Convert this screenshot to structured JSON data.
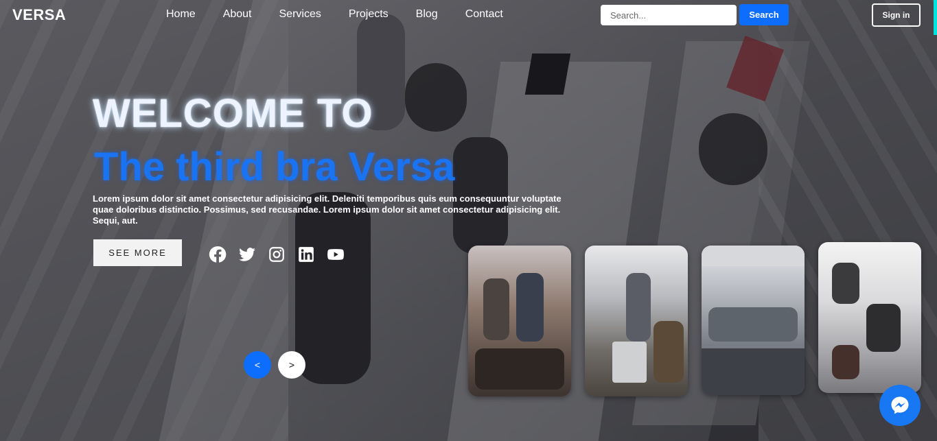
{
  "navbar": {
    "logo": "VERSA",
    "links": [
      "Home",
      "About",
      "Services",
      "Projects",
      "Blog",
      "Contact"
    ],
    "search_placeholder": "Search...",
    "search_label": "Search",
    "signin_label": "Sign in"
  },
  "hero": {
    "title": "WELCOME TO",
    "subtitle": "The third bra Versa",
    "text": "Lorem ipsum dolor sit amet consectetur adipisicing elit. Deleniti temporibus quis eum consequuntur voluptate quae doloribus distinctio. Possimus, sed recusandae. Lorem ipsum dolor sit amet consectetur adipisicing elit. Sequi, aut.",
    "see_more_label": "SEE MORE",
    "prev_label": "<",
    "next_label": ">"
  },
  "socials": [
    "facebook-icon",
    "twitter-icon",
    "instagram-icon",
    "linkedin-icon",
    "youtube-icon"
  ],
  "colors": {
    "accent": "#0d6efd",
    "subtitle": "#1a73f0",
    "messenger": "#1877f2"
  }
}
